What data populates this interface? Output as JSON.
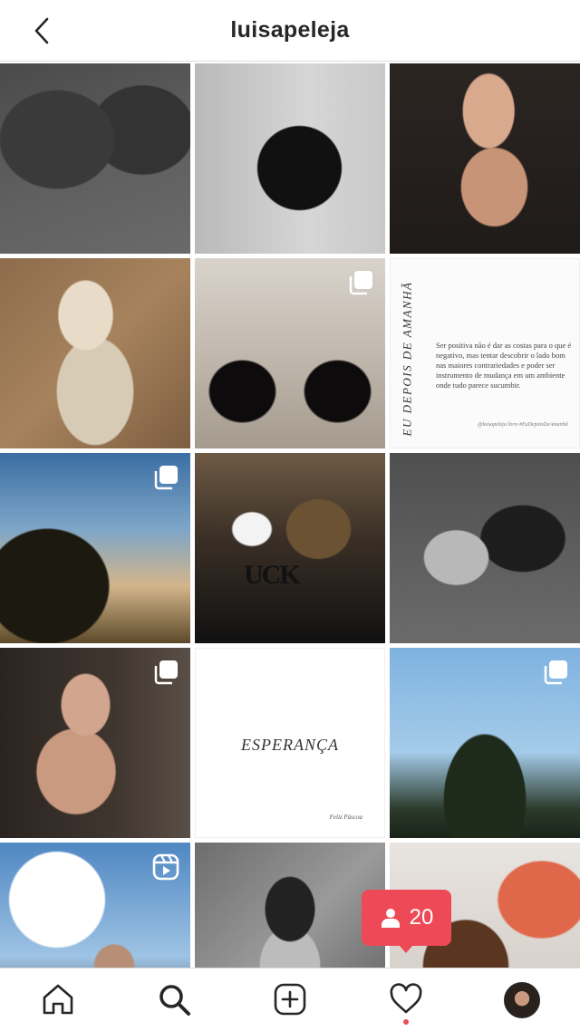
{
  "header": {
    "title": "luisapeleja",
    "back_icon": "chevron-left-icon"
  },
  "grid": {
    "posts": [
      {
        "subject": "black sneakers",
        "badge": null
      },
      {
        "subject": "black dress",
        "badge": null
      },
      {
        "subject": "smiling woman",
        "badge": null
      },
      {
        "subject": "woman on floor",
        "badge": null
      },
      {
        "subject": "mirror black dress",
        "badge": "carousel-icon"
      },
      {
        "subject": "book page",
        "badge": null
      },
      {
        "subject": "sunset landscape",
        "badge": "carousel-icon"
      },
      {
        "subject": "handbag and mug",
        "badge": null
      },
      {
        "subject": "couple",
        "badge": null
      },
      {
        "subject": "woman portrait",
        "badge": "carousel-icon"
      },
      {
        "subject": "esperanca text",
        "badge": null
      },
      {
        "subject": "araucaria trees",
        "badge": "carousel-icon"
      },
      {
        "subject": "sky pose",
        "badge": "reels-icon"
      },
      {
        "subject": "pool black and white",
        "badge": null
      },
      {
        "subject": "chocolate egg",
        "badge": null
      }
    ],
    "book_post": {
      "spine_text": "EU DEPOIS DE AMANHÃ",
      "quote": "Ser positiva não é dar as costas para o que é negativo, mas tentar descobrir o lado bom nas maiores contrariedades e poder ser instrumento de mudança em um ambiente onde tudo parece sucumbir.",
      "handle": "@luisapeleja livro #EuDepoisDeAmanhã"
    },
    "esperanca_post": {
      "word": "ESPERANÇA",
      "subtitle": "Feliz Páscoa"
    },
    "mug_text": "UCK"
  },
  "notification": {
    "icon": "person-icon",
    "count": "20",
    "color": "#ed4956"
  },
  "bottom_nav": {
    "items": [
      "home-icon",
      "search-icon",
      "add-post-icon",
      "heart-icon",
      "profile-avatar"
    ],
    "active": "search-icon",
    "activity_dot_color": "#ed4956"
  }
}
